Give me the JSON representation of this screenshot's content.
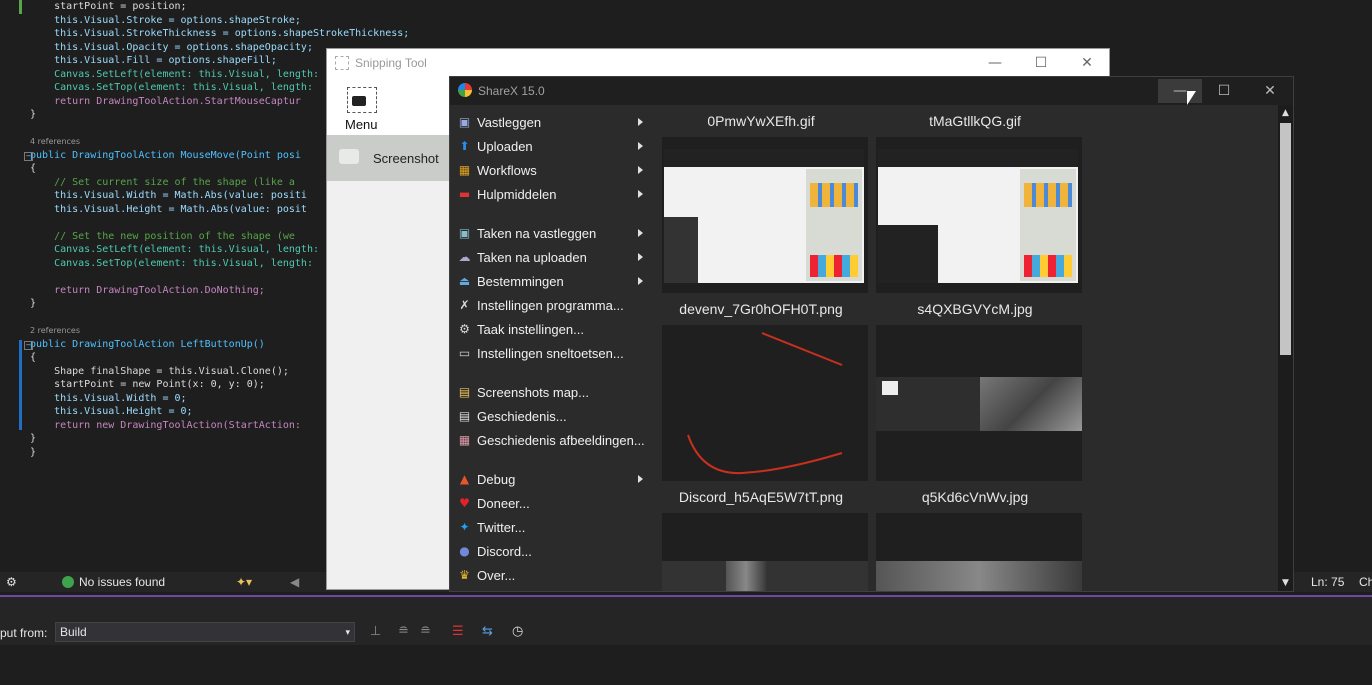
{
  "editor": {
    "lines": [
      {
        "text": "    startPoint = position;",
        "kind": "code"
      },
      {
        "text": "    this.Visual.Stroke = options.shapeStroke;",
        "kind": "code"
      },
      {
        "text": "    this.Visual.StrokeThickness = options.shapeStrokeThickness;",
        "kind": "code"
      },
      {
        "text": "    this.Visual.Opacity = options.shapeOpacity;",
        "kind": "code"
      },
      {
        "text": "    this.Visual.Fill = options.shapeFill;",
        "kind": "code"
      },
      {
        "text": "    Canvas.SetLeft(element: this.Visual, length:",
        "kind": "code"
      },
      {
        "text": "    Canvas.SetTop(element: this.Visual, length:",
        "kind": "code"
      },
      {
        "text": "    return DrawingToolAction.StartMouseCaptur",
        "kind": "code"
      },
      {
        "text": "}",
        "kind": "code"
      },
      {
        "text": "",
        "kind": "code"
      },
      {
        "text": "4 references",
        "kind": "ref"
      },
      {
        "text": "public DrawingToolAction MouseMove(Point posi",
        "kind": "code"
      },
      {
        "text": "{",
        "kind": "code"
      },
      {
        "text": "    // Set current size of the shape (like a",
        "kind": "comment"
      },
      {
        "text": "    this.Visual.Width = Math.Abs(value: positi",
        "kind": "code"
      },
      {
        "text": "    this.Visual.Height = Math.Abs(value: posit",
        "kind": "code"
      },
      {
        "text": "",
        "kind": "code"
      },
      {
        "text": "    // Set the new position of the shape (we",
        "kind": "comment"
      },
      {
        "text": "    Canvas.SetLeft(element: this.Visual, length:",
        "kind": "code"
      },
      {
        "text": "    Canvas.SetTop(element: this.Visual, length:",
        "kind": "code"
      },
      {
        "text": "",
        "kind": "code"
      },
      {
        "text": "    return DrawingToolAction.DoNothing;",
        "kind": "code"
      },
      {
        "text": "}",
        "kind": "code"
      },
      {
        "text": "",
        "kind": "code"
      },
      {
        "text": "2 references",
        "kind": "ref"
      },
      {
        "text": "public DrawingToolAction LeftButtonUp()",
        "kind": "code"
      },
      {
        "text": "{",
        "kind": "code"
      },
      {
        "text": "    Shape finalShape = this.Visual.Clone();",
        "kind": "code"
      },
      {
        "text": "    startPoint = new Point(x: 0, y: 0);",
        "kind": "code"
      },
      {
        "text": "    this.Visual.Width = 0;",
        "kind": "code"
      },
      {
        "text": "    this.Visual.Height = 0;",
        "kind": "code"
      },
      {
        "text": "    return new DrawingToolAction(StartAction:",
        "kind": "code"
      },
      {
        "text": "}",
        "kind": "code"
      },
      {
        "text": "}",
        "kind": "code"
      }
    ]
  },
  "statusbar": {
    "issues": "No issues found",
    "line": "Ln: 75",
    "col": "Ch"
  },
  "output": {
    "label": "put from:",
    "source": "Build"
  },
  "snipping_tool": {
    "title": "Snipping Tool",
    "menu_label": "Menu",
    "screenshot_label": "Screenshot"
  },
  "sharex": {
    "title": "ShareX 15.0",
    "menu": [
      {
        "label": "Vastleggen",
        "icon": "capture-icon",
        "submenu": true
      },
      {
        "label": "Uploaden",
        "icon": "upload-arrow-icon",
        "submenu": true
      },
      {
        "label": "Workflows",
        "icon": "workflows-grid-icon",
        "submenu": true
      },
      {
        "label": "Hulpmiddelen",
        "icon": "toolbox-icon",
        "submenu": true
      },
      {
        "label": "Taken na vastleggen",
        "icon": "after-capture-icon",
        "submenu": true
      },
      {
        "label": "Taken na uploaden",
        "icon": "cloud-upload-icon",
        "submenu": true
      },
      {
        "label": "Bestemmingen",
        "icon": "destinations-icon",
        "submenu": true
      },
      {
        "label": "Instellingen programma...",
        "icon": "wrench-icon",
        "submenu": false
      },
      {
        "label": "Taak instellingen...",
        "icon": "gear-icon",
        "submenu": false
      },
      {
        "label": "Instellingen sneltoetsen...",
        "icon": "keyboard-icon",
        "submenu": false
      },
      {
        "label": "Screenshots map...",
        "icon": "folder-icon",
        "submenu": false
      },
      {
        "label": "Geschiedenis...",
        "icon": "history-icon",
        "submenu": false
      },
      {
        "label": "Geschiedenis afbeeldingen...",
        "icon": "image-history-icon",
        "submenu": false
      },
      {
        "label": "Debug",
        "icon": "debug-cone-icon",
        "submenu": true
      },
      {
        "label": "Doneer...",
        "icon": "heart-icon",
        "submenu": false
      },
      {
        "label": "Twitter...",
        "icon": "twitter-icon",
        "submenu": false
      },
      {
        "label": "Discord...",
        "icon": "discord-icon",
        "submenu": false
      },
      {
        "label": "Over...",
        "icon": "crown-icon",
        "submenu": false
      }
    ],
    "thumbnails": [
      {
        "name": "0PmwYwXEfh.gif"
      },
      {
        "name": "tMaGtllkQG.gif"
      },
      {
        "name": "devenv_7Gr0hOFH0T.png"
      },
      {
        "name": "s4QXBGVYcM.jpg"
      },
      {
        "name": "Discord_h5AqE5W7tT.png"
      },
      {
        "name": "q5Kd6cVnWv.jpg"
      }
    ],
    "colors": {
      "accent": "#1e88e5",
      "background": "#2b2b2b"
    }
  }
}
